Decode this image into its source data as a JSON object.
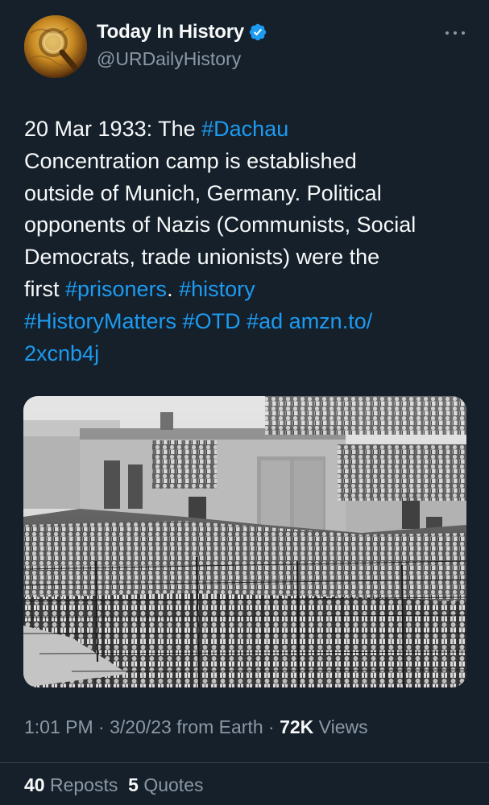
{
  "author": {
    "display_name": "Today In History",
    "handle": "@URDailyHistory",
    "verified": true,
    "verified_color": "#1d9bf0",
    "avatar_icon": "magnifying-glass-map-avatar"
  },
  "tweet": {
    "lines": [
      [
        {
          "t": "20 Mar 1933: The ",
          "link": false
        },
        {
          "t": "#Dachau",
          "link": true
        }
      ],
      [
        {
          "t": "Concentration camp is established",
          "link": false
        }
      ],
      [
        {
          "t": "outside of Munich, Germany. Political",
          "link": false
        }
      ],
      [
        {
          "t": "opponents of Nazis (Communists, Social",
          "link": false
        }
      ],
      [
        {
          "t": "Democrats, trade unionists) were the",
          "link": false
        }
      ],
      [
        {
          "t": "first ",
          "link": false
        },
        {
          "t": "#prisoners",
          "link": true
        },
        {
          "t": ". ",
          "link": false
        },
        {
          "t": "#history",
          "link": true
        }
      ],
      [
        {
          "t": "#HistoryMatters",
          "link": true
        },
        {
          "t": " ",
          "link": false
        },
        {
          "t": "#OTD",
          "link": true
        },
        {
          "t": " ",
          "link": false
        },
        {
          "t": "#ad",
          "link": true
        },
        {
          "t": " ",
          "link": false
        },
        {
          "t": "amzn.to/",
          "link": true
        }
      ],
      [
        {
          "t": "2xcnb4j",
          "link": true
        }
      ]
    ],
    "link_color": "#1d9bf0",
    "image_alt": "black-and-white photograph of prisoners standing behind a barbed wire fence in front of a building"
  },
  "meta": {
    "time": "1:01 PM",
    "sep1": " · ",
    "date": "3/20/23",
    "source": " from Earth",
    "sep2": " · ",
    "views_count": "72K",
    "views_label": " Views"
  },
  "stats": {
    "reposts_count": "40",
    "reposts_label": " Reposts",
    "quotes_count": "5",
    "quotes_label": " Quotes"
  },
  "colors": {
    "background": "#15202b",
    "text": "#f7f9f9",
    "secondary": "#8b98a5"
  },
  "more_icon": "more-horizontal-icon"
}
